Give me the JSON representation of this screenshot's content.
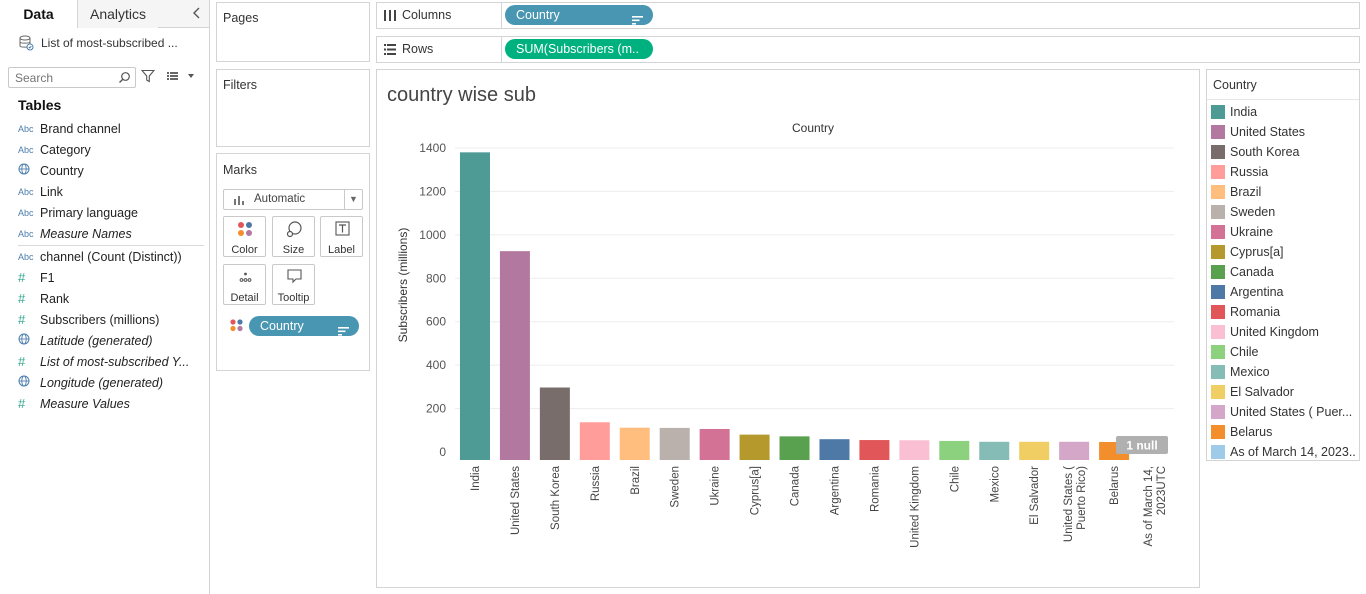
{
  "data_pane": {
    "tabs": [
      "Data",
      "Analytics"
    ],
    "datasource_name": "List of most-subscribed ...",
    "search_placeholder": "Search",
    "tables_heading": "Tables",
    "fields": [
      {
        "type": "Abc",
        "name": "Brand channel",
        "italic": false
      },
      {
        "type": "Abc",
        "name": "Category",
        "italic": false
      },
      {
        "type": "geo",
        "name": "Country",
        "italic": false
      },
      {
        "type": "Abc",
        "name": "Link",
        "italic": false
      },
      {
        "type": "Abc",
        "name": "Primary language",
        "italic": false
      },
      {
        "type": "Abc",
        "name": "Measure Names",
        "italic": true
      },
      {
        "type": "Abc",
        "name": "channel (Count (Distinct))",
        "italic": false
      },
      {
        "type": "#",
        "name": "F1",
        "italic": false
      },
      {
        "type": "#",
        "name": "Rank",
        "italic": false
      },
      {
        "type": "#",
        "name": "Subscribers (millions)",
        "italic": false
      },
      {
        "type": "geo",
        "name": "Latitude (generated)",
        "italic": true
      },
      {
        "type": "#",
        "name": "List of most-subscribed Y...",
        "italic": true
      },
      {
        "type": "geo",
        "name": "Longitude (generated)",
        "italic": true
      },
      {
        "type": "#",
        "name": "Measure Values",
        "italic": true
      }
    ]
  },
  "cards": {
    "pages": "Pages",
    "filters": "Filters",
    "marks": "Marks",
    "mark_type": "Automatic",
    "mark_buttons": {
      "color": "Color",
      "size": "Size",
      "label": "Label",
      "detail": "Detail",
      "tooltip": "Tooltip"
    },
    "marks_pill": "Country"
  },
  "shelves": {
    "columns_label": "Columns",
    "columns_pill": "Country",
    "rows_label": "Rows",
    "rows_pill": "SUM(Subscribers (m.."
  },
  "sheet_title": "country wise sub",
  "legend": {
    "title": "Country",
    "items": [
      {
        "label": "India",
        "color": "#4e9a95"
      },
      {
        "label": "United States",
        "color": "#b3789f"
      },
      {
        "label": "South Korea",
        "color": "#786d6a"
      },
      {
        "label": "Russia",
        "color": "#ff9d9a"
      },
      {
        "label": "Brazil",
        "color": "#ffbe7d"
      },
      {
        "label": "Sweden",
        "color": "#bab0ac"
      },
      {
        "label": "Ukraine",
        "color": "#d37295"
      },
      {
        "label": "Cyprus[a]",
        "color": "#b6992d"
      },
      {
        "label": "Canada",
        "color": "#59a14f"
      },
      {
        "label": "Argentina",
        "color": "#4e79a7"
      },
      {
        "label": "Romania",
        "color": "#e15759"
      },
      {
        "label": "United Kingdom",
        "color": "#fabfd2"
      },
      {
        "label": "Chile",
        "color": "#8cd17d"
      },
      {
        "label": "Mexico",
        "color": "#86bcb6"
      },
      {
        "label": "El Salvador",
        "color": "#f1ce63"
      },
      {
        "label": "United States ( Puer...",
        "color": "#d4a6c8"
      },
      {
        "label": "Belarus",
        "color": "#f28e2b"
      },
      {
        "label": "As of March 14, 2023...",
        "color": "#a0cbe8"
      }
    ]
  },
  "chart_data": {
    "type": "bar",
    "header": "Country",
    "ylabel": "Subscribers (millions)",
    "ylim": [
      0,
      1400
    ],
    "yticks": [
      0,
      200,
      400,
      600,
      800,
      1000,
      1200,
      1400
    ],
    "null_indicator": "1 null",
    "categories": [
      "India",
      "United States",
      "South Korea",
      "Russia",
      "Brazil",
      "Sweden",
      "Ukraine",
      "Cyprus[a]",
      "Canada",
      "Argentina",
      "Romania",
      "United Kingdom",
      "Chile",
      "Mexico",
      "El Salvador",
      "United States ( Puerto Rico)",
      "Belarus",
      "As of March 14, 2023UTC"
    ],
    "tick_labels": [
      [
        "India"
      ],
      [
        "United States"
      ],
      [
        "South Korea"
      ],
      [
        "Russia"
      ],
      [
        "Brazil"
      ],
      [
        "Sweden"
      ],
      [
        "Ukraine"
      ],
      [
        "Cyprus[a]"
      ],
      [
        "Canada"
      ],
      [
        "Argentina"
      ],
      [
        "Romania"
      ],
      [
        "United Kingdom"
      ],
      [
        "Chile"
      ],
      [
        "Mexico"
      ],
      [
        "El Salvador"
      ],
      [
        "United States (",
        "Puerto Rico)"
      ],
      [
        "Belarus"
      ],
      [
        "As of March 14,",
        "2023UTC"
      ]
    ],
    "values": [
      1380,
      925,
      297,
      137,
      112,
      111,
      106,
      80,
      72,
      59,
      55,
      54,
      51,
      47,
      47,
      47,
      46,
      0
    ],
    "colors": [
      "#4e9a95",
      "#b3789f",
      "#786d6a",
      "#ff9d9a",
      "#ffbe7d",
      "#bab0ac",
      "#d37295",
      "#b6992d",
      "#59a14f",
      "#4e79a7",
      "#e15759",
      "#fabfd2",
      "#8cd17d",
      "#86bcb6",
      "#f1ce63",
      "#d4a6c8",
      "#f28e2b",
      "#a0cbe8"
    ]
  }
}
